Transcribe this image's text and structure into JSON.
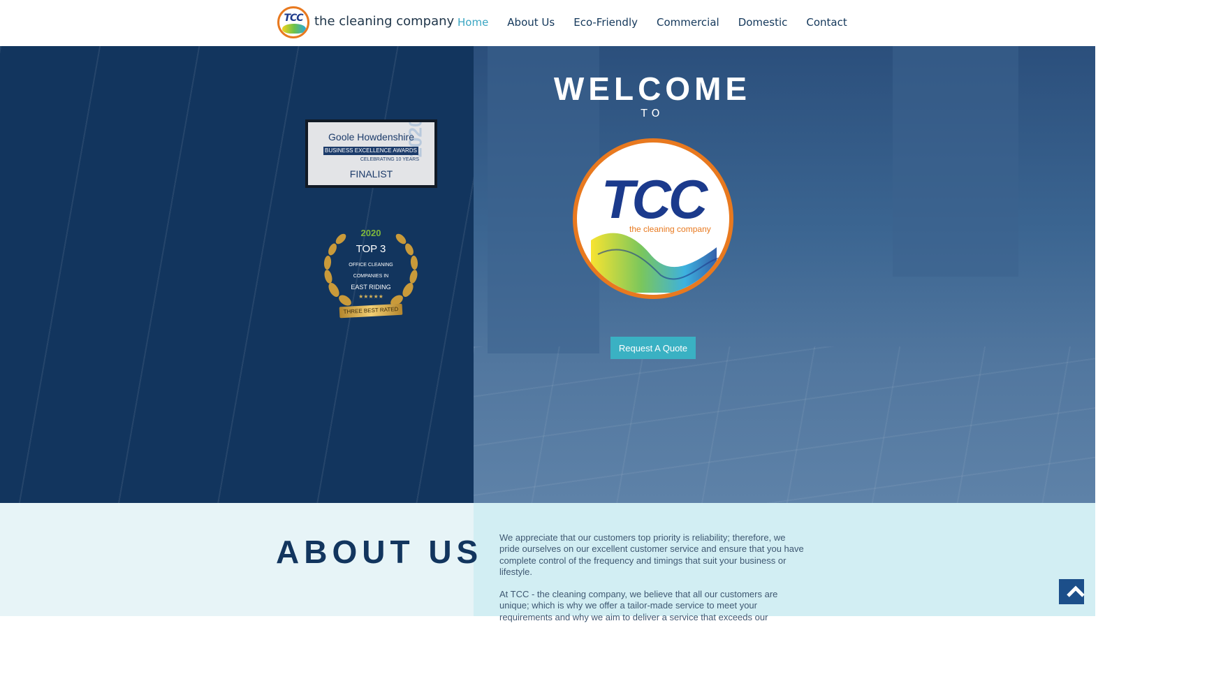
{
  "header": {
    "logo_text": "TCC",
    "brand": "the cleaning company",
    "nav": [
      {
        "label": "Home",
        "active": true
      },
      {
        "label": "About Us"
      },
      {
        "label": "Eco-Friendly"
      },
      {
        "label": "Commercial"
      },
      {
        "label": "Domestic"
      },
      {
        "label": "Contact"
      }
    ]
  },
  "hero": {
    "welcome": "WELCOME",
    "to": "TO",
    "badge_text": "TCC",
    "badge_sub": "the cleaning company",
    "quote_button": "Request A Quote"
  },
  "award_goole": {
    "title": "Goole  Howdenshire",
    "bar": "BUSINESS EXCELLENCE AWARDS",
    "celebrating": "CELEBRATING 10 YEARS",
    "status": "FINALIST",
    "year": "2020"
  },
  "award_top3": {
    "year": "2020",
    "title": "TOP 3",
    "line1": "OFFICE CLEANING",
    "line2": "COMPANIES IN",
    "line3": "EAST RIDING",
    "stars": "★★★★★",
    "ribbon": "THREE BEST RATED"
  },
  "about": {
    "title": "ABOUT US",
    "p1": "We appreciate that our customers top priority is reliability; therefore, we pride ourselves on our excellent customer service and ensure that you have complete control of the frequency and timings that suit your business or lifestyle.",
    "p2": "At TCC - the cleaning company, we believe that all our customers are unique; which is why we offer a tailor-made service to meet your requirements and why we aim to deliver a service that exceeds our"
  },
  "colors": {
    "navy": "#12355e",
    "accent_teal": "#3ab1c3",
    "logo_orange": "#e8791f"
  },
  "icons": {
    "back_to_top": "chevron-up-icon"
  }
}
